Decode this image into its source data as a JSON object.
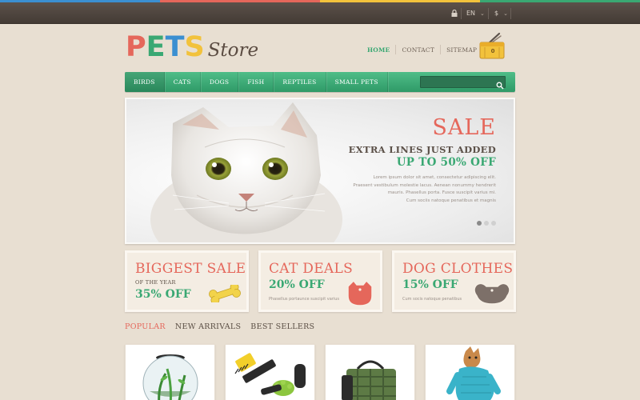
{
  "colors": {
    "accent_green": "#3aa873",
    "accent_red": "#e5675b",
    "strip": [
      "#3b8fd1",
      "#e5675b",
      "#f2c23c",
      "#3aa873"
    ]
  },
  "topbar": {
    "language": "EN",
    "currency": "$"
  },
  "logo": {
    "pets": "PETS",
    "store": "Store",
    "letter_colors": [
      "#e5675b",
      "#3aa873",
      "#3b8fd1",
      "#f2c23c"
    ]
  },
  "topnav": [
    {
      "label": "HOME",
      "active": true
    },
    {
      "label": "CONTACT",
      "active": false
    },
    {
      "label": "SITEMAP",
      "active": false
    }
  ],
  "cart": {
    "count": "0"
  },
  "categories": [
    {
      "label": "BIRDS",
      "active": true
    },
    {
      "label": "CATS"
    },
    {
      "label": "DOGS"
    },
    {
      "label": "FISH"
    },
    {
      "label": "REPTILES"
    },
    {
      "label": "SMALL PETS"
    }
  ],
  "search": {
    "value": ""
  },
  "slider": {
    "title": "SALE",
    "line1": "EXTRA LINES JUST ADDED",
    "line2": "UP TO 50% OFF",
    "desc": [
      "Lorem ipsum dolor sit amet, consectetur adipiscing elit.",
      "Praesent vestibulum molestie lacus. Aenean nonummy hendrerit",
      "mauris. Phasellus porta. Fusce suscipit varius mi.",
      "Cum sociis natoque penatibus et magnis"
    ],
    "dots": 3,
    "active_dot": 1
  },
  "promos": [
    {
      "title": "BIGGEST SALE",
      "sub": "OF THE YEAR",
      "pct": "35% OFF",
      "icon": "bone-icon"
    },
    {
      "title": "CAT DEALS",
      "pct": "20% OFF",
      "small": "Phasellus portaunce suscipit varius",
      "icon": "cat-tag-icon"
    },
    {
      "title": "DOG CLOTHES",
      "pct": "15% OFF",
      "small": "Cum socis natoque penatibus",
      "icon": "dog-tag-icon"
    }
  ],
  "tabs": [
    {
      "label": "POPULAR",
      "active": true
    },
    {
      "label": "NEW ARRIVALS"
    },
    {
      "label": "BEST SELLERS"
    }
  ],
  "products": [
    {
      "name": "fish-bowl-image"
    },
    {
      "name": "grooming-brush-image"
    },
    {
      "name": "pet-carrier-image"
    },
    {
      "name": "dog-sweater-image"
    }
  ]
}
